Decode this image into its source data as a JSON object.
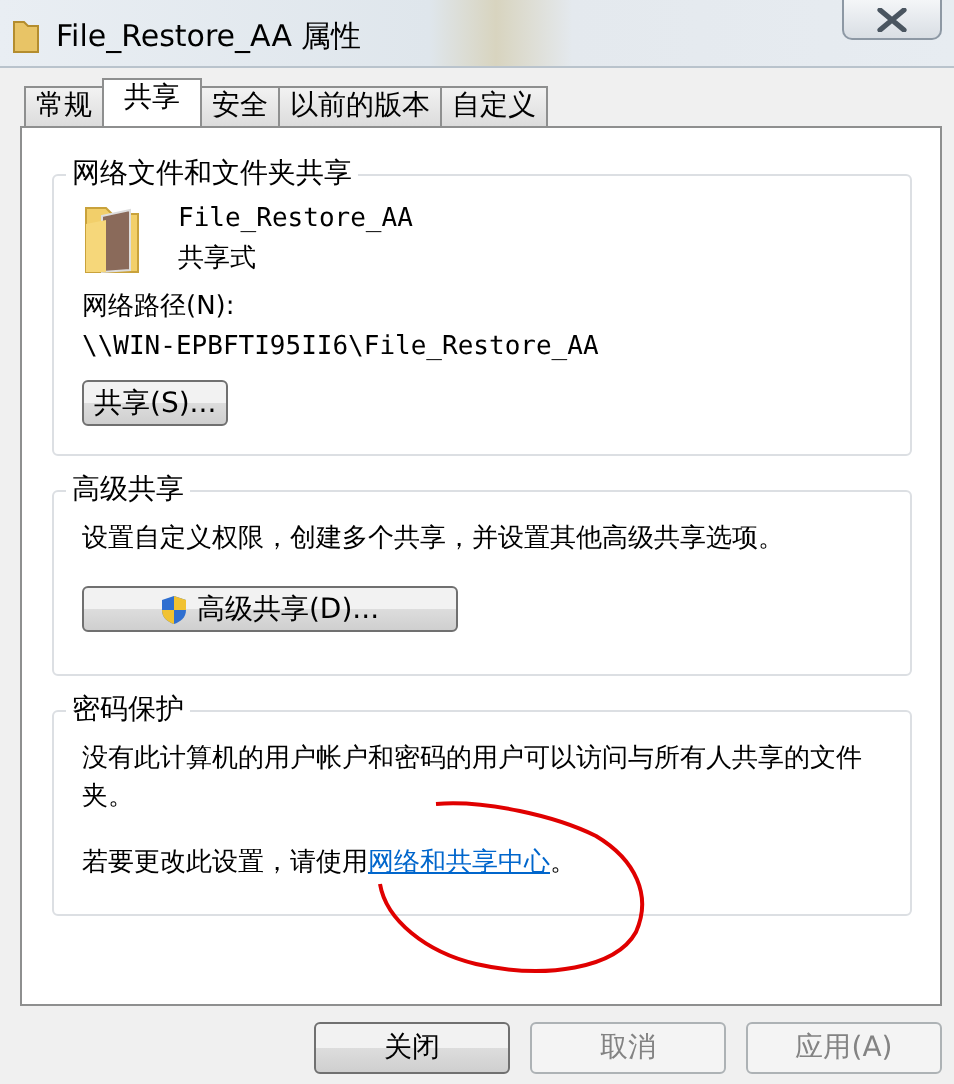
{
  "window": {
    "title": "File_Restore_AA 属性"
  },
  "tabs": [
    {
      "label": "常规",
      "selected": false
    },
    {
      "label": "共享",
      "selected": true
    },
    {
      "label": "安全",
      "selected": false
    },
    {
      "label": "以前的版本",
      "selected": false
    },
    {
      "label": "自定义",
      "selected": false
    }
  ],
  "network_sharing": {
    "heading": "网络文件和文件夹共享",
    "folder_name": "File_Restore_AA",
    "status": "共享式",
    "path_label": "网络路径(N):",
    "path": "\\\\WIN-EPBFTI95II6\\File_Restore_AA",
    "button": "共享(S)..."
  },
  "advanced_sharing": {
    "heading": "高级共享",
    "description": "设置自定义权限，创建多个共享，并设置其他高级共享选项。",
    "button": "高级共享(D)..."
  },
  "password_protection": {
    "heading": "密码保护",
    "description": "没有此计算机的用户帐户和密码的用户可以访问与所有人共享的文件夹。",
    "change_text": "若要更改此设置，请使用",
    "link": "网络和共享中心",
    "suffix": "。"
  },
  "buttons": [
    {
      "label": "关闭",
      "disabled": false
    },
    {
      "label": "取消",
      "disabled": true
    },
    {
      "label": "应用(A)",
      "disabled": true
    }
  ]
}
